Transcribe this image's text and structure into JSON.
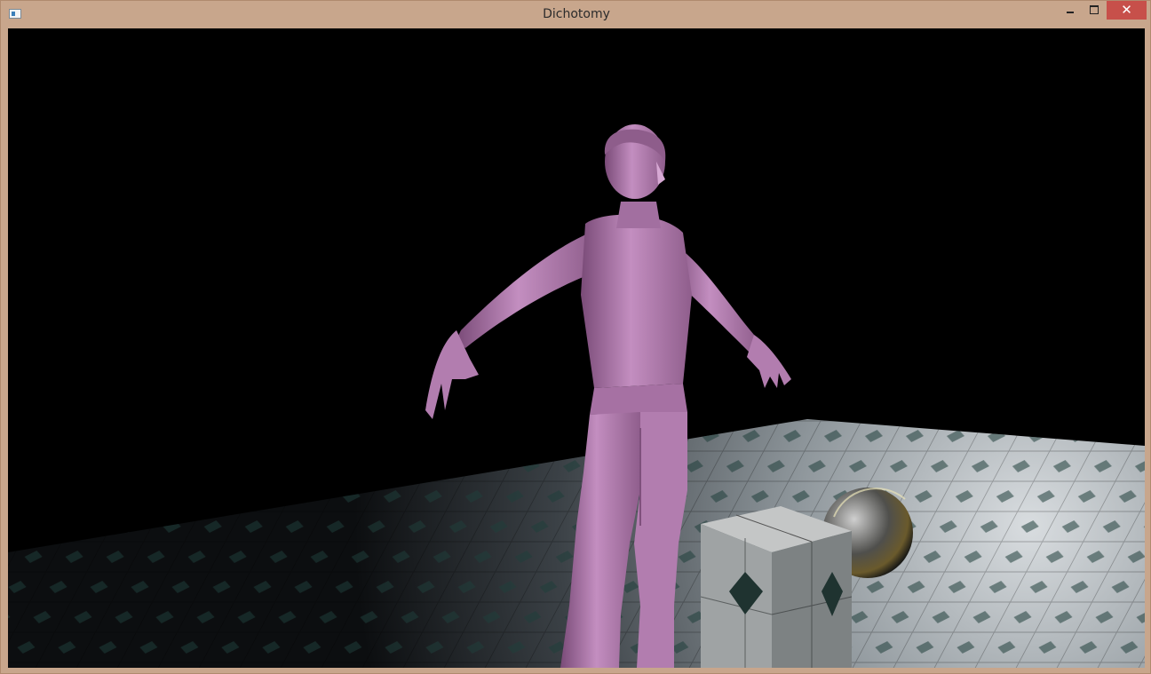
{
  "window": {
    "title": "Dichotomy",
    "controls": {
      "minimize_icon": "minimize-icon",
      "maximize_icon": "maximize-icon",
      "close_glyph": "✕"
    }
  },
  "scene": {
    "background_color": "#000000",
    "character_color": "#b77fb4",
    "floor_color": "#8f969a",
    "objects": [
      "character",
      "tiled-floor",
      "stone-cube",
      "metallic-sphere"
    ]
  }
}
